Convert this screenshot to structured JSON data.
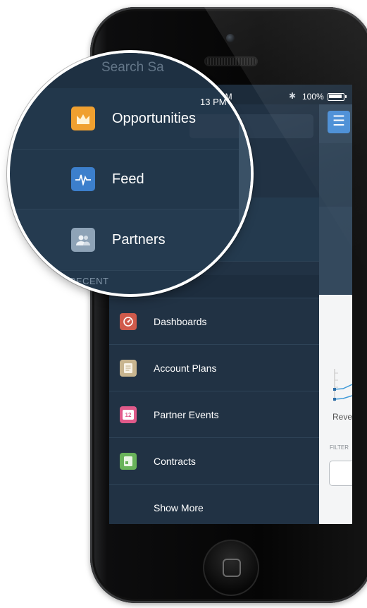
{
  "phone": {
    "status_time": "13 PM",
    "battery": "100%"
  },
  "magnifier": {
    "search_placeholder": "Search Sa",
    "items": [
      {
        "label": "Opportunities",
        "icon": "crown-icon",
        "color": "#f0a030"
      },
      {
        "label": "Feed",
        "icon": "pulse-icon",
        "color": "#3c7fcc"
      },
      {
        "label": "Partners",
        "icon": "people-icon",
        "color": "#8ea3b7"
      }
    ],
    "section_header": "RECENT"
  },
  "menu": {
    "items": [
      {
        "label": "Dashboards",
        "icon": "speedometer-icon",
        "color": "#d05a4b"
      },
      {
        "label": "Account Plans",
        "icon": "document-icon",
        "color": "#c8b58f"
      },
      {
        "label": "Partner Events",
        "icon": "calendar-icon",
        "color": "#e05a8a",
        "icon_text": "12"
      },
      {
        "label": "Contracts",
        "icon": "contract-icon",
        "color": "#69b35a"
      }
    ],
    "show_more": "Show More"
  },
  "main_view": {
    "chart_label": "Reve",
    "filter_label": "FILTER"
  }
}
